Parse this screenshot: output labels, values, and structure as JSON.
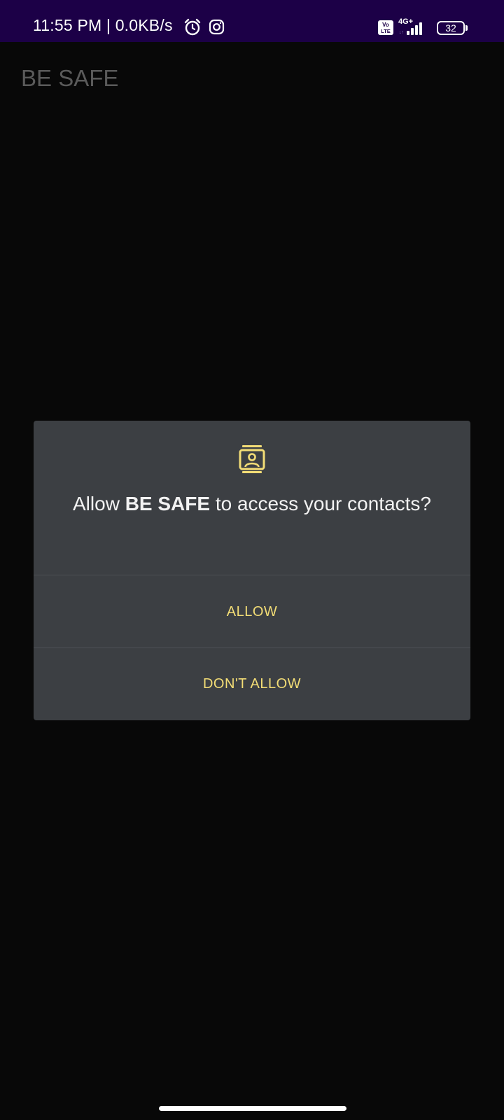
{
  "status_bar": {
    "time": "11:55 PM | 0.0KB/s",
    "network_type": "4G+",
    "volte_label": "Vo LTE",
    "battery_level": "32",
    "icons": [
      "alarm-icon",
      "instagram-icon",
      "volte-icon",
      "signal-icon",
      "battery-icon"
    ]
  },
  "app": {
    "title": "BE SAFE"
  },
  "dialog": {
    "icon": "contacts-icon",
    "message_prefix": "Allow ",
    "app_name": "BE SAFE",
    "message_suffix": " to access your contacts?",
    "allow_label": "ALLOW",
    "deny_label": "DON'T ALLOW",
    "accent_color": "#f3dd76",
    "background_color": "#3c3f43"
  },
  "colors": {
    "status_bar": "#1c0047",
    "screen_background": "#080808",
    "title_text": "#5a5a5a"
  }
}
